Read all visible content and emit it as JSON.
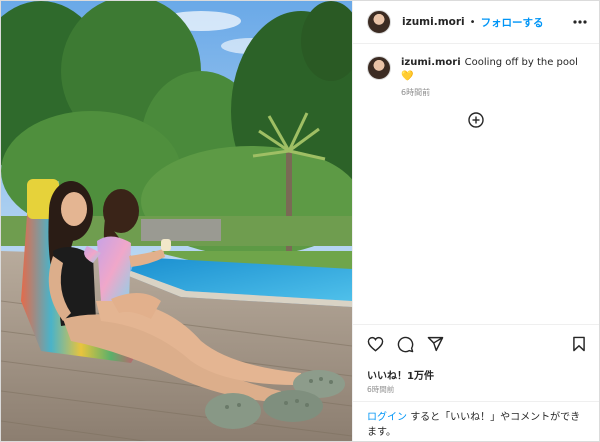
{
  "post": {
    "username": "izumi.mori",
    "separator": "•",
    "follow_label": "フォローする",
    "caption_text": "Cooling off by the pool",
    "caption_emoji": "💛",
    "caption_time": "6時間前",
    "likes": "いいね！1万件",
    "posted_time": "6時間前",
    "login_prompt": "ログインすると「いいね！」やコメントができます。"
  },
  "icons": {
    "more": "more-options-icon",
    "add_comment": "plus-circle-icon",
    "like": "heart-icon",
    "comment": "comment-icon",
    "share": "share-icon",
    "save": "bookmark-icon"
  },
  "colors": {
    "link": "#0095f6",
    "text": "#262626",
    "muted": "#8e8e8e",
    "border": "#efefef"
  }
}
